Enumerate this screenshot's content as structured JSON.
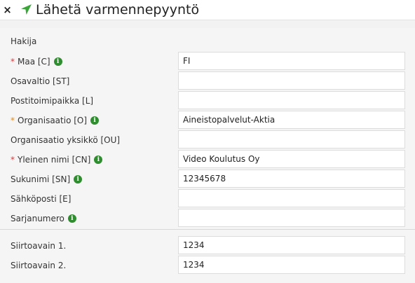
{
  "header": {
    "close_glyph": "×",
    "title": "Lähetä varmennepyyntö",
    "send_icon_color": "#3aa63a"
  },
  "form": {
    "section_label": "Hakija",
    "fields": [
      {
        "label": "Maa [C]",
        "value": "FI",
        "required": true,
        "info": true
      },
      {
        "label": "Osavaltio [ST]",
        "value": "",
        "required": false,
        "info": false
      },
      {
        "label": "Postitoimipaikka [L]",
        "value": "",
        "required": false,
        "info": false
      },
      {
        "label": "Organisaatio [O]",
        "value": "Aineistopalvelut-Aktia",
        "required": true,
        "info": true
      },
      {
        "label": "Organisaatio yksikkö [OU]",
        "value": "",
        "required": false,
        "info": false
      },
      {
        "label": "Yleinen nimi [CN]",
        "value": "Video Koulutus Oy",
        "required": true,
        "info": true
      },
      {
        "label": "Sukunimi [SN]",
        "value": "12345678",
        "required": false,
        "info": true
      },
      {
        "label": "Sähköposti [E]",
        "value": "",
        "required": false,
        "info": false
      },
      {
        "label": "Sarjanumero",
        "value": "",
        "required": false,
        "info": true
      }
    ],
    "transfer_keys": [
      {
        "label": "Siirtoavain 1.",
        "value": "1234"
      },
      {
        "label": "Siirtoavain 2.",
        "value": "1234"
      }
    ]
  },
  "colors": {
    "required_red": "#d04040",
    "required_orange": "#e08a1e",
    "info_green": "#2f8c2f"
  },
  "glyphs": {
    "required_marker": "*",
    "info_marker": "i"
  }
}
